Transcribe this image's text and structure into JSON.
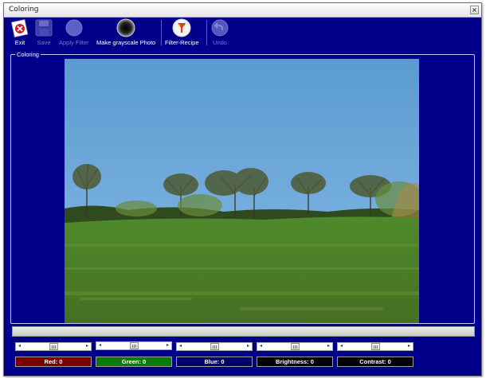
{
  "window": {
    "title": "Coloring",
    "close_glyph": "×"
  },
  "toolbar": {
    "buttons": [
      {
        "label": "Exit",
        "icon": "exit-icon",
        "enabled": true
      },
      {
        "label": "Save",
        "icon": "save-disk-icon",
        "enabled": false
      },
      {
        "label": "Apply Filter",
        "icon": "apply-filter-icon",
        "enabled": false
      },
      {
        "label": "Make grayscale Photo",
        "icon": "grayscale-lens-icon",
        "enabled": true
      },
      {
        "label": "Filter-Recipe",
        "icon": "filter-recipe-icon",
        "enabled": true
      },
      {
        "label": "Undo",
        "icon": "undo-icon",
        "enabled": false
      }
    ]
  },
  "group": {
    "label": "Coloring"
  },
  "photo": {
    "description_icon": "landscape-photo"
  },
  "progress": {
    "value": 0
  },
  "sliders": [
    {
      "name": "red",
      "value": 0,
      "arrow_left": "◂",
      "arrow_right": "▸"
    },
    {
      "name": "green",
      "value": 0,
      "arrow_left": "◂",
      "arrow_right": "▸"
    },
    {
      "name": "blue",
      "value": 0,
      "arrow_left": "◂",
      "arrow_right": "▸"
    },
    {
      "name": "brightness",
      "value": 0,
      "arrow_left": "◂",
      "arrow_right": "▸"
    },
    {
      "name": "contrast",
      "value": 0,
      "arrow_left": "◂",
      "arrow_right": "▸"
    }
  ],
  "channels": [
    {
      "label": "Red: 0",
      "color": "#7a0000"
    },
    {
      "label": "Green: 0",
      "color": "#0a7a0a"
    },
    {
      "label": "Blue: 0",
      "color": "#00006a"
    },
    {
      "label": "Brightness: 0",
      "color": "#000000"
    },
    {
      "label": "Contrast: 0",
      "color": "#000000"
    }
  ]
}
